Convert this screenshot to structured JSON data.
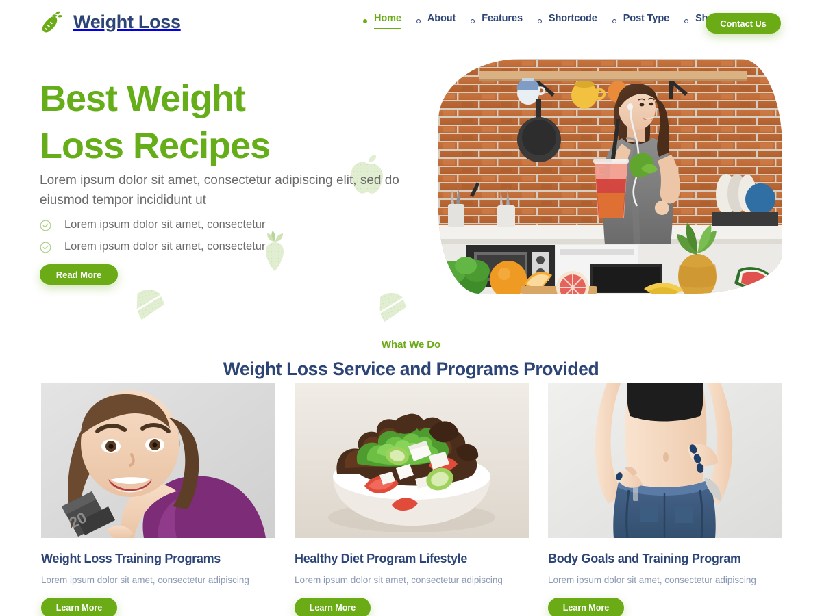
{
  "header": {
    "brand": {
      "name": "Weight Loss",
      "logo_icon": "carrot-icon"
    },
    "nav": [
      {
        "label": "Home",
        "active": true
      },
      {
        "label": "About",
        "active": false
      },
      {
        "label": "Features",
        "active": false
      },
      {
        "label": "Shortcode",
        "active": false
      },
      {
        "label": "Post Type",
        "active": false
      },
      {
        "label": "Shop",
        "active": false
      }
    ],
    "contact_label": "Contact Us"
  },
  "hero": {
    "title_line1": "Best Weight",
    "title_line2": "Loss Recipes",
    "subtitle": "Lorem ipsum dolor sit amet, consectetur adipiscing elit, sed do eiusmod tempor incididunt ut",
    "bullets": [
      "Lorem ipsum dolor sit amet, consectetur",
      "Lorem ipsum dolor sit amet, consectetur"
    ],
    "cta_label": "Read More",
    "image_alt": "Woman in kitchen holding a smoothie with fresh fruit and vegetables"
  },
  "services": {
    "eyebrow": "What We Do",
    "title": "Weight Loss Service and Programs Provided",
    "cards": [
      {
        "title": "Weight Loss Training Programs",
        "desc": "Lorem ipsum dolor sit amet, consectetur adipiscing",
        "cta_label": "Learn More",
        "image_alt": "Smiling woman in purple tank top lifting a dumbbell"
      },
      {
        "title": "Healthy Diet Program Lifestyle",
        "desc": "Lorem ipsum dolor sit amet, consectetur adipiscing",
        "cta_label": "Learn More",
        "image_alt": "Bowl of green salad with tomatoes and cheese"
      },
      {
        "title": "Body Goals and Training Program",
        "desc": "Lorem ipsum dolor sit amet, consectetur adipiscing",
        "cta_label": "Learn More",
        "image_alt": "Slim waist in oversized jeans showing weight loss"
      }
    ]
  },
  "colors": {
    "brand_green": "#6aab16",
    "heading_green": "#66ae19",
    "navy": "#2d4477",
    "body_gray": "#6b6b6b",
    "muted_blue": "#8c9ab5",
    "deco_green": "#e2eed2",
    "page_bg": "#ffffff"
  }
}
